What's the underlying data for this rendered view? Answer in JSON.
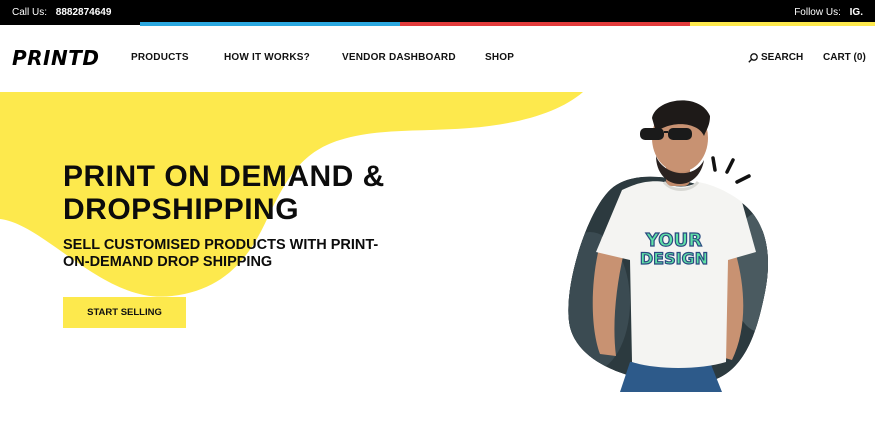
{
  "topbar": {
    "call_label": "Call Us:",
    "phone": "8882874649",
    "follow_label": "Follow Us:",
    "ig_label": "IG."
  },
  "header": {
    "logo": "PRINTD",
    "nav": [
      "PRODUCTS",
      "HOW IT WORKS?",
      "VENDOR DASHBOARD",
      "SHOP"
    ],
    "search_label": "SEARCH",
    "cart_label": "CART (0)"
  },
  "hero": {
    "title": "PRINT ON DEMAND & DROPSHIPPING",
    "subtitle": "SELL CUSTOMISED PRODUCTS WITH PRINT-ON-DEMAND DROP SHIPPING",
    "cta_label": "START SELLING",
    "tshirt_text_line1": "YOUR",
    "tshirt_text_line2": "DESIGN"
  },
  "colors": {
    "accent_yellow": "#fde94d",
    "topbar_bg": "#000000",
    "stripe_blue": "#2ba8e0",
    "stripe_red": "#e23b3b",
    "stripe_yellow": "#fde94d",
    "shirt_print_green": "#5fe0a6",
    "shirt_print_blue": "#2a4a80"
  },
  "icons": {
    "search": "search-icon"
  }
}
